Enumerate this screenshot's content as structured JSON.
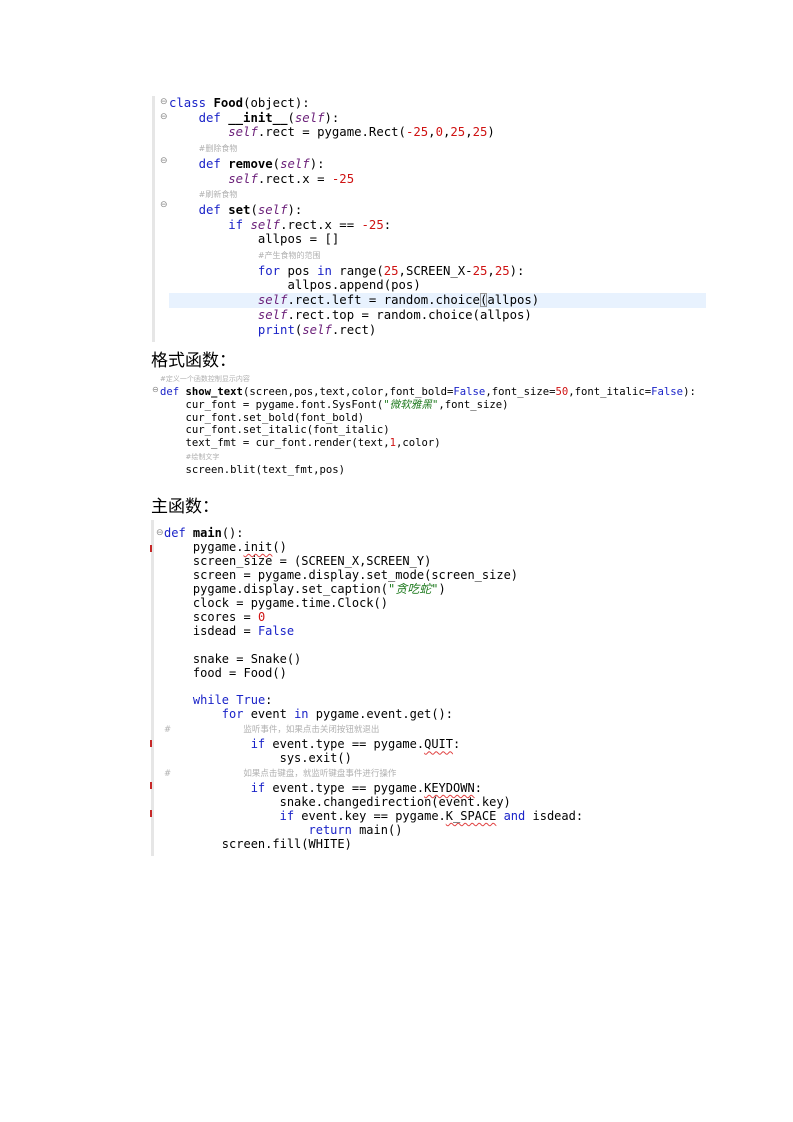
{
  "food_class": {
    "l1": {
      "kw": "class",
      "name": "Food",
      "rest": "(object):"
    },
    "l2": {
      "kw": "def",
      "name": "__init__",
      "open": "(",
      "self": "self",
      "close": "):"
    },
    "l3": {
      "self": "self",
      "mid": ".rect = pygame.Rect(",
      "n1": "-25",
      "c1": ",",
      "n2": "0",
      "c2": ",",
      "n3": "25",
      "c3": ",",
      "n4": "25",
      "end": ")"
    },
    "c1": "#删除食物",
    "l5": {
      "kw": "def",
      "name": "remove",
      "open": "(",
      "self": "self",
      "close": "):"
    },
    "l6": {
      "self": "self",
      "mid": ".rect.x = ",
      "num": "-25"
    },
    "c2": "#刷新食物",
    "l8": {
      "kw": "def",
      "name": "set",
      "open": "(",
      "self": "self",
      "close": "):"
    },
    "l9": {
      "kw": "if",
      "self": "self",
      "mid": ".rect.x == ",
      "num": "-25",
      "end": ":"
    },
    "l10": "allpos = []",
    "c3": "#产生食物的范围",
    "l12": {
      "kw1": "for",
      "a": " pos ",
      "kw2": "in",
      "b": " range(",
      "n1": "25",
      "c": ",SCREEN_X-",
      "n2": "25",
      "c2": ",",
      "n3": "25",
      "end": "):"
    },
    "l13": "allpos.append(pos)",
    "l14": {
      "self": "self",
      "mid": ".rect.left = random.choice",
      "br": "(",
      "end": "allpos)"
    },
    "l15": {
      "self": "self",
      "mid": ".rect.top = random.choice(allpos)"
    },
    "l16": {
      "kw": "print",
      "open": "(",
      "self": "self",
      "end": ".rect)"
    }
  },
  "heading1": "格式函数：",
  "show_text": {
    "c0": "#定义一个函数控制显示内容",
    "l1": {
      "kw": "def",
      "name": "show_text",
      "a": "(screen,pos,text,color,font_bold=",
      "k1": "False",
      "b": ",font_size=",
      "n1": "50",
      "c": ",font_italic=",
      "k2": "False",
      "end": "):"
    },
    "l2": {
      "a": "cur_font = pygame.font.SysFont(",
      "str": "\"微软雅黑\"",
      "end": ",font_size)"
    },
    "l3": "cur_font.set_bold(font_bold)",
    "l4": "cur_font.set_italic(font_italic)",
    "l5": {
      "a": "text_fmt = cur_font.render(text,",
      "n": "1",
      "end": ",color)"
    },
    "c1": "#绘制文字",
    "l6": "screen.blit(text_fmt,pos)"
  },
  "heading2": "主函数：",
  "main_func": {
    "l1": {
      "kw": "def",
      "name": "main",
      "end": "():"
    },
    "l2": {
      "a": "pygame.",
      "u": "init",
      "end": "()"
    },
    "l3": "screen_size = (SCREEN_X,SCREEN_Y)",
    "l4": "screen = pygame.display.set_mode(screen_size)",
    "l5": {
      "a": "pygame.display.set_caption(",
      "str": "\"贪吃蛇\"",
      "end": ")"
    },
    "l6": "clock = pygame.time.Clock()",
    "l7": {
      "a": "scores = ",
      "n": "0"
    },
    "l8": {
      "a": "isdead = ",
      "k": "False"
    },
    "l9": "snake = Snake()",
    "l10": "food = Food()",
    "l11": {
      "kw": "while",
      "sp": " ",
      "k": "True",
      "end": ":"
    },
    "l12": {
      "kw1": "for",
      "a": " event ",
      "kw2": "in",
      "b": " pygame.event.get():"
    },
    "c1": {
      "hash": "#",
      "text": "监听事件，如果点击关闭按钮就退出"
    },
    "l13": {
      "kw": "if",
      "a": " event.type == pygame.",
      "u": "QUIT",
      "end": ":"
    },
    "l14": "sys.exit()",
    "c2": {
      "hash": "#",
      "text": "如果点击键盘，就监听键盘事件进行操作"
    },
    "l15": {
      "kw": "if",
      "a": " event.type == pygame.",
      "u": "KEYDOWN",
      "end": ":"
    },
    "l16": "snake.changedirection(event.key)",
    "l17": {
      "kw": "if",
      "a": " event.key == pygame.",
      "u": "K_SPACE",
      "sp": " ",
      "kw2": "and",
      "end": " isdead:"
    },
    "l18": {
      "kw": "return",
      "end": " main()"
    },
    "l19": "screen.fill(WHITE)"
  },
  "colors": {
    "keyword": "#1a23c8",
    "self": "#6a1e78",
    "number": "#cf1313",
    "string": "#1f7a1f",
    "comment": "#b0b0b0",
    "highlight": "#e8f2fe"
  }
}
